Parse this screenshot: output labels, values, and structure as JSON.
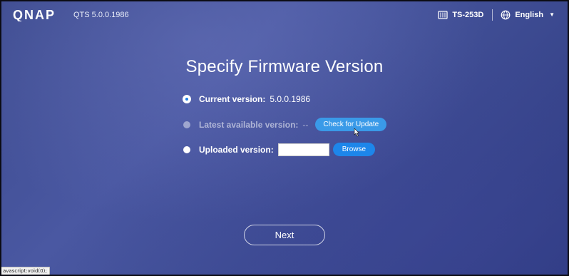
{
  "header": {
    "logo_text": "QNAP",
    "qts_version": "QTS 5.0.0.1986",
    "device_model": "TS-253D",
    "language": "English",
    "icons": {
      "device": "nas-icon",
      "language": "globe-icon",
      "dropdown": "caret-down-icon"
    }
  },
  "main": {
    "title": "Specify Firmware Version",
    "options": {
      "current": {
        "label": "Current version:",
        "value": "5.0.0.1986",
        "selected": true
      },
      "latest": {
        "label": "Latest available version:",
        "value": "--",
        "button": "Check for Update",
        "disabled": true
      },
      "uploaded": {
        "label": "Uploaded version:",
        "input_value": "",
        "button": "Browse"
      }
    },
    "next_label": "Next"
  },
  "status_bar": {
    "text": "avascript:void(0);"
  },
  "colors": {
    "background": "#4a58a2",
    "primary_button": "#1d86ea",
    "secondary_button": "#3a9ae8"
  }
}
